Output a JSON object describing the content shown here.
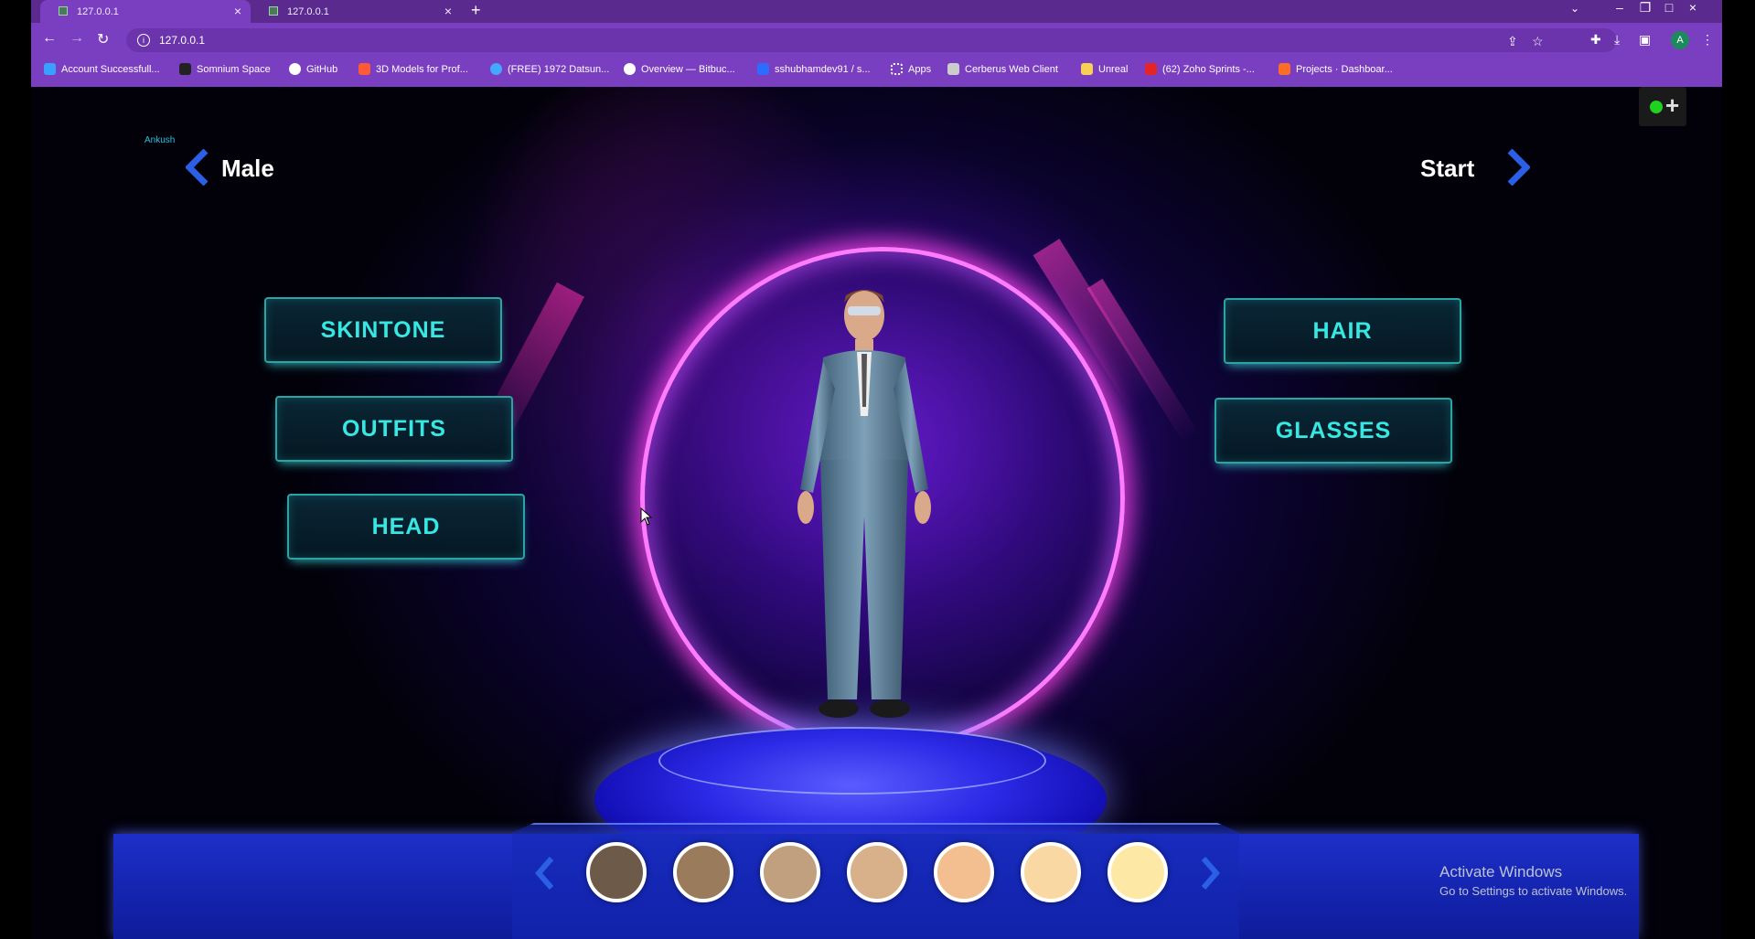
{
  "browser": {
    "tabs": [
      {
        "title": "127.0.0.1",
        "active": true
      },
      {
        "title": "127.0.0.1",
        "active": false
      }
    ],
    "url": "127.0.0.1",
    "bookmarks": [
      {
        "label": "Account Successfull...",
        "color": "#3aa0ff"
      },
      {
        "label": "Somnium Space",
        "color": "#222222"
      },
      {
        "label": "GitHub",
        "color": "#ffffff"
      },
      {
        "label": "3D Models for Prof...",
        "color": "#ff5a36"
      },
      {
        "label": "(FREE) 1972 Datsun...",
        "color": "#46a7ff"
      },
      {
        "label": "Overview — Bitbuc...",
        "color": "#ffffff"
      },
      {
        "label": "sshubhamdev91 / s...",
        "color": "#2d6cff"
      },
      {
        "label": "Apps",
        "color": "#7a3fc1"
      },
      {
        "label": "Cerberus Web Client",
        "color": "#cccccc"
      },
      {
        "label": "Unreal",
        "color": "#f7d154"
      },
      {
        "label": "(62) Zoho Sprints -...",
        "color": "#e42527"
      },
      {
        "label": "Projects · Dashboar...",
        "color": "#fc6d26"
      }
    ],
    "avatar_initial": "A"
  },
  "game": {
    "player_name": "Ankush",
    "gender_label": "Male",
    "start_label": "Start",
    "menu": {
      "skintone": "SKINTONE",
      "outfits": "OUTFITS",
      "head": "HEAD",
      "hair": "HAIR",
      "glasses": "GLASSES"
    },
    "skin_swatches": [
      "#6e5a48",
      "#9a7b5c",
      "#c0a07e",
      "#d8b08a",
      "#f3bf90",
      "#f9d8a4",
      "#fde8a6"
    ],
    "accent_color": "#37e7e2"
  },
  "watermark": {
    "title": "Activate Windows",
    "subtitle": "Go to Settings to activate Windows."
  }
}
